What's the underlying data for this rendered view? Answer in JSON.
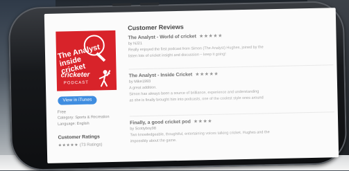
{
  "left_panel": {
    "artwork": {
      "title": "The Analyst inside cricket",
      "brand": "cricketer",
      "subtitle": "PODCAST"
    },
    "view_button": "View in iTunes",
    "price": "Free",
    "category": "Category: Sports & Recreation",
    "language": "Language: English",
    "ratings_heading": "Customer Ratings",
    "ratings_stars": "★★★★★",
    "ratings_count": "(73 Ratings)"
  },
  "reviews": {
    "heading": "Customer Reviews",
    "items": [
      {
        "title": "The Analyst - World of cricket",
        "stars": "★★★★★",
        "author": "by NJ21",
        "lines": [
          "Really enjoyed the first podcast from Simon (The Analyst) Hughes, joined by the",
          "listen lots of cricket insight and discussion – keep it going!"
        ]
      },
      {
        "title": "The Analyst - Inside Cricket",
        "stars": "★★★★★",
        "author": "by Mike1993",
        "lines": [
          "A great addition.",
          "Simon has always been a source of brilliance, experience and understanding",
          "as she is finally brought him into podcasts, one of the coolest style ones around"
        ]
      },
      {
        "title": "Finally, a good cricket pod",
        "stars": "★★★★",
        "author": "by Scottyboy98",
        "lines": [
          "Two knowledgeable, thoughtful, entertaining voices talking cricket. Hughes and the",
          "impossibly about the game."
        ]
      }
    ]
  }
}
